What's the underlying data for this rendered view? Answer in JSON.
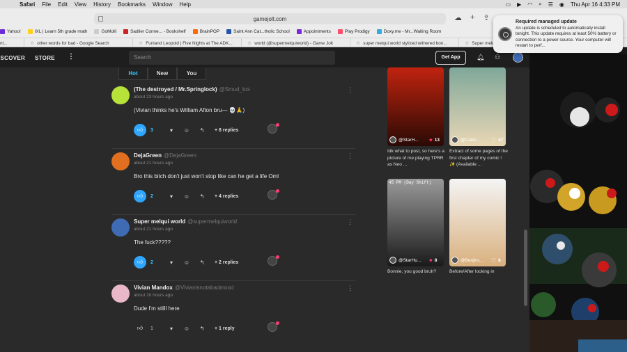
{
  "menubar": {
    "app": "Safari",
    "menus": [
      "File",
      "Edit",
      "View",
      "History",
      "Bookmarks",
      "Window",
      "Help"
    ],
    "datetime": "Thu Apr 16  4:33 PM"
  },
  "browser": {
    "url": "gamejolt.com",
    "bookmarks": [
      {
        "label": "Yahoo!",
        "color": "#6b2bd9"
      },
      {
        "label": "IXL | Learn 5th grade math",
        "color": "#ffd11a"
      },
      {
        "label": "GoMolli",
        "color": "#cccccc"
      },
      {
        "label": "Sadlier Conne... - Bookshelf",
        "color": "#cc2222"
      },
      {
        "label": "BrainPOP",
        "color": "#ff6a00"
      },
      {
        "label": "Saint Ann Cat...tholic School",
        "color": "#2255aa"
      },
      {
        "label": "Appointments",
        "color": "#7a2bd9"
      },
      {
        "label": "Play Prodigy",
        "color": "#ff4d6d"
      },
      {
        "label": "Doxy.me - Mr...Waiting Room",
        "color": "#33aadd"
      }
    ],
    "tabs": [
      {
        "label": "nt..."
      },
      {
        "label": "other words for bad - Google Search"
      },
      {
        "label": "Funland Leopold | Five Nights at The ADK..."
      },
      {
        "label": "world (@supermelquiworld) - Game Jolt"
      },
      {
        "label": "super melqui world stylized withered bon..."
      },
      {
        "label": "Super melqui world on Ga..."
      }
    ]
  },
  "notification": {
    "title": "Required managed update",
    "body": "An update is scheduled to automatically install tonight. This update requires at least 50% battery or connection to a power source. Your computer will restart to perf..."
  },
  "gamejolt": {
    "nav": {
      "discover": "ISCOVER",
      "store": "STORE",
      "search_placeholder": "Search",
      "get_app": "Get App"
    },
    "sort_tabs": [
      {
        "label": "Hot",
        "active": true
      },
      {
        "label": "New",
        "active": false
      },
      {
        "label": "You",
        "active": false
      }
    ],
    "comments": [
      {
        "name": "(The destroyed / Mr.Springlock)",
        "handle": "@Smud_boi",
        "time": "about 23 hours ago",
        "text": "(Vivian thinks he's William Afton bru— 💀🙏)",
        "likes": "3",
        "liked": true,
        "replies": "+ 8 replies",
        "avatar_color": "#b6e23a"
      },
      {
        "name": "DejaGreen",
        "handle": "@DejaGreen",
        "time": "about 21 hours ago",
        "text": "Bro this bitch don't just won't stop like can he get a life Oml",
        "likes": "2",
        "liked": true,
        "replies": "+ 4 replies",
        "avatar_color": "#e0701f"
      },
      {
        "name": "Super melqui world",
        "handle": "@supermelquiworld",
        "time": "about 21 hours ago",
        "text": "The fuck?????",
        "likes": "2",
        "liked": true,
        "replies": "+ 2 replies",
        "avatar_color": "#3f6bb5"
      },
      {
        "name": "Vivian Mandox",
        "handle": "@Vivianisnotabadmood",
        "time": "about 10 hours ago",
        "text": "Dude I'm stilll here",
        "likes": "1",
        "liked": false,
        "replies": "+ 1 reply",
        "avatar_color": "#e8b8c8"
      }
    ],
    "feed": [
      {
        "user": "@StarH...",
        "likes": "13",
        "liked": true,
        "caption": "Idk what to post, so here's a picture of me playing TPRR as Neo ..."
      },
      {
        "user": "@Catst...",
        "likes": "47",
        "liked": false,
        "caption": "Extract of some pages of the first chapter of my comic ! ✨ (Available ..."
      },
      {
        "user": "@StarHu...",
        "likes": "8",
        "liked": true,
        "caption": "Bonnie, you good bruh?",
        "overlay": "45 PM (Day Shift)"
      },
      {
        "user": "@Benjiro...",
        "likes": "8",
        "liked": false,
        "caption": "Before/After locking in"
      }
    ]
  }
}
